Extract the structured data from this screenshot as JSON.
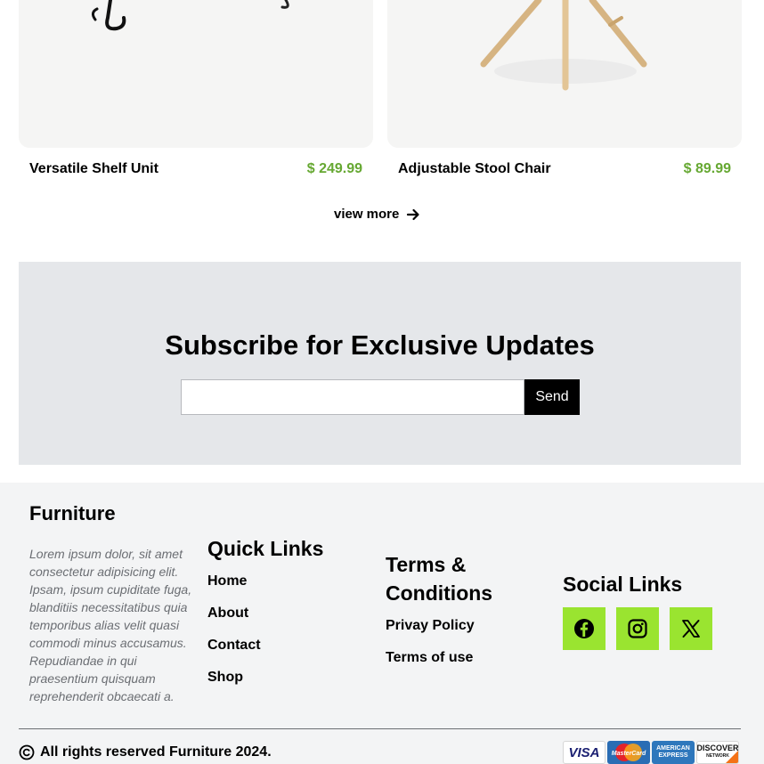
{
  "products": [
    {
      "name": "Versatile Shelf Unit",
      "price": "$ 249.99"
    },
    {
      "name": "Adjustable Stool Chair",
      "price": "$ 89.99"
    }
  ],
  "view_more": {
    "label": "view more",
    "icon": "arrow-right-icon"
  },
  "subscribe": {
    "title": "Subscribe for Exclusive Updates",
    "input_placeholder": "",
    "button_label": "Send"
  },
  "footer": {
    "brand": {
      "name": "Furniture",
      "description": "Lorem ipsum dolor, sit amet consectetur adipisicing elit. Ipsam, ipsum cupiditate fuga, blanditiis necessitatibus quia temporibus alias velit quasi commodi minus accusamus. Repudiandae in qui praesentium quisquam reprehenderit obcaecati a."
    },
    "quick_links": {
      "title": "Quick Links",
      "items": [
        "Home",
        "About",
        "Contact",
        "Shop"
      ]
    },
    "terms": {
      "title": "Terms & Conditions",
      "items": [
        "Privay Policy",
        "Terms of use"
      ]
    },
    "social": {
      "title": "Social Links",
      "icons": [
        "facebook-icon",
        "instagram-icon",
        "x-icon"
      ]
    },
    "copyright": "All rights reserved Furniture 2024.",
    "payments": {
      "visa": "VISA",
      "mastercard": "MasterCard",
      "amex": "AMERICAN EXPRESS",
      "discover": "DISCOVER",
      "discover_sub": "NETWORK"
    }
  },
  "colors": {
    "price": "#66a832",
    "social_bg": "#9ae430",
    "subscribe_bg": "#e5e7ea",
    "footer_bg": "#f3f4f5"
  }
}
